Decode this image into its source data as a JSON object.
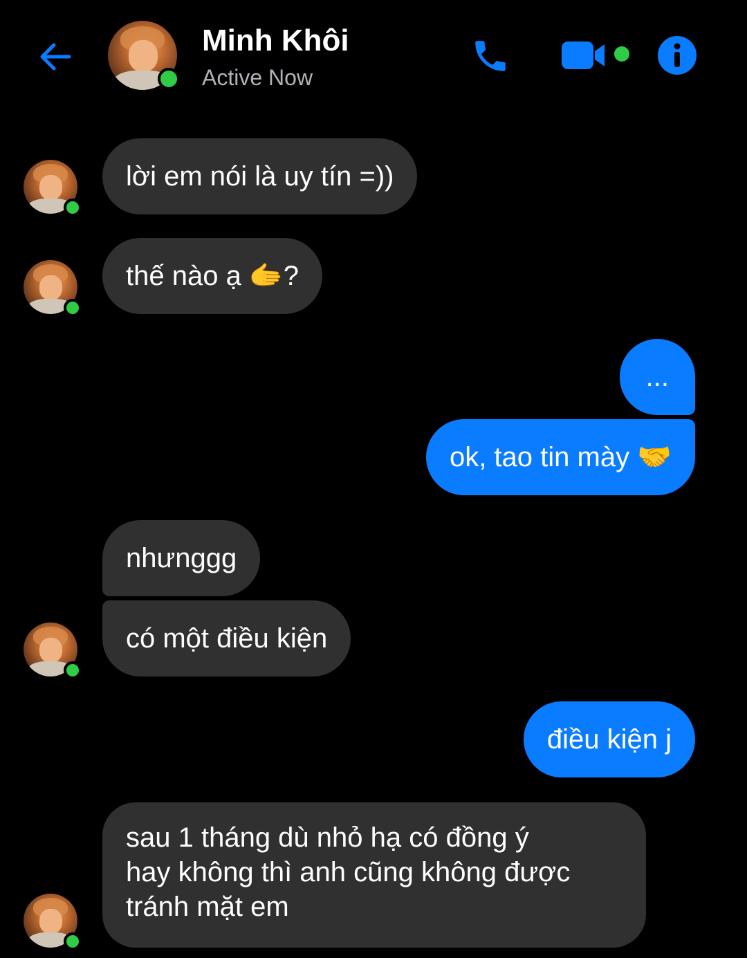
{
  "header": {
    "contact_name": "Minh Khôi",
    "status": "Active Now",
    "accent_color": "#0a7cff",
    "online_color": "#31cc46",
    "icons": [
      "back-arrow-icon",
      "phone-icon",
      "video-camera-icon",
      "info-icon"
    ]
  },
  "messages": [
    {
      "direction": "incoming",
      "text": "lời em nói là uy tín =))"
    },
    {
      "direction": "incoming",
      "text": "thế nào ạ 🫱?"
    },
    {
      "direction": "outgoing",
      "text": "..."
    },
    {
      "direction": "outgoing",
      "text": "ok, tao tin mày 🤝"
    },
    {
      "direction": "incoming",
      "text": "nhưnggg"
    },
    {
      "direction": "incoming",
      "text": "có một điều kiện"
    },
    {
      "direction": "outgoing",
      "text": "điều kiện j"
    },
    {
      "direction": "incoming",
      "text": "sau 1 tháng dù nhỏ hạ có đồng ý hay không thì anh cũng không được tránh mặt em",
      "lines": [
        "sau 1 tháng dù nhỏ hạ có đồng ý",
        "hay không thì anh cũng không được",
        "tránh mặt em"
      ]
    }
  ],
  "colors": {
    "incoming_bubble": "#303030",
    "outgoing_bubble": "#0a7cff",
    "background": "#000000"
  }
}
